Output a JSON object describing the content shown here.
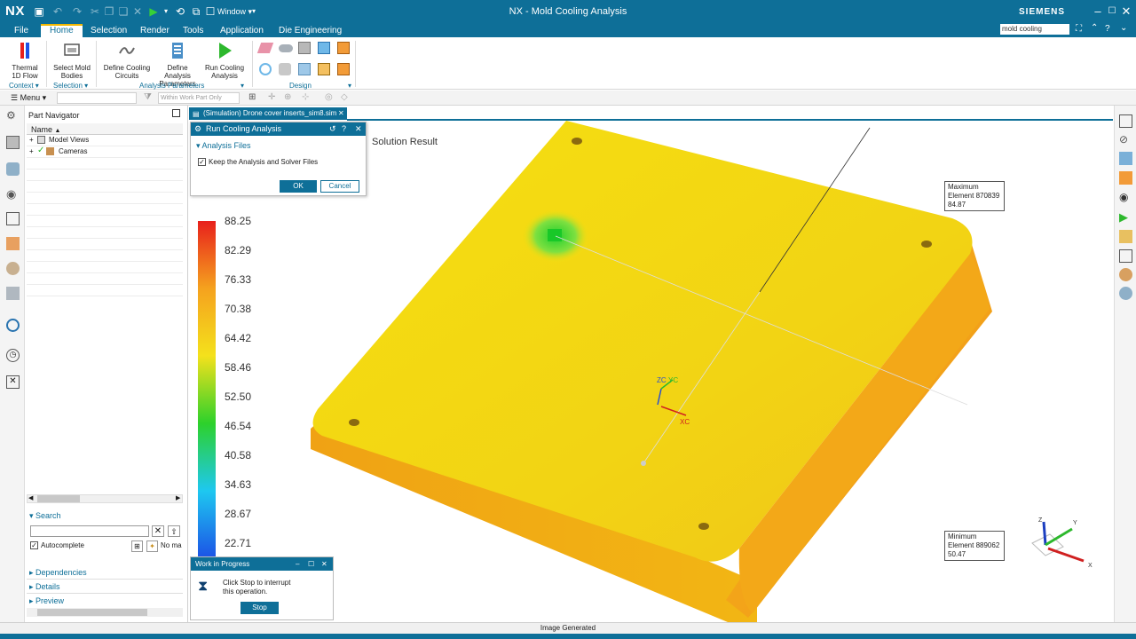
{
  "app": {
    "logo": "NX",
    "window_title": "NX - Mold Cooling Analysis",
    "brand": "SIEMENS",
    "window_menu": "Window"
  },
  "menu_tabs": [
    {
      "label": "File"
    },
    {
      "label": "Home"
    },
    {
      "label": "Selection"
    },
    {
      "label": "Render"
    },
    {
      "label": "Tools"
    },
    {
      "label": "Application"
    },
    {
      "label": "Die Engineering"
    }
  ],
  "command_search": {
    "value": "mold cooling"
  },
  "ribbon": {
    "thermal_flow": "Thermal 1D Flow",
    "select_mold_bodies": "Select Mold Bodies",
    "define_cooling_circuits": "Define Cooling Circuits",
    "define_analysis_parameters": "Define Analysis Parameters",
    "run_cooling_analysis": "Run Cooling Analysis",
    "groups": {
      "context": "Context",
      "selection": "Selection",
      "analysis_parameters": "Analysis Parameters",
      "design": "Design"
    }
  },
  "toolbar": {
    "menu_label": "Menu",
    "filter_placeholder": "Within Work Part Only"
  },
  "part_navigator": {
    "title": "Part Navigator",
    "column_name": "Name",
    "items": [
      {
        "label": "Model Views"
      },
      {
        "label": "Cameras"
      }
    ],
    "sections": {
      "search": "Search",
      "autocomplete": "Autocomplete",
      "no_match": "No ma",
      "dependencies": "Dependencies",
      "details": "Details",
      "preview": "Preview"
    }
  },
  "sim_tab": {
    "label": "(Simulation) Drone cover inserts_sim8.sim"
  },
  "dialog": {
    "title": "Run Cooling Analysis",
    "section": "Analysis Files",
    "checkbox_label": "Keep the Analysis and Solver Files",
    "checkbox_checked": true,
    "ok": "OK",
    "cancel": "Cancel"
  },
  "viewport": {
    "solution_result": "Solution Result",
    "max_annot": {
      "line1": "Maximum",
      "line2": "Element 870839",
      "line3": "84.87"
    },
    "min_annot": {
      "line1": "Minimum",
      "line2": "Element 889062",
      "line3": "50.47"
    },
    "axis_labels": {
      "zc": "ZC",
      "yc": "YC",
      "xc": "XC",
      "x": "X",
      "y": "Y",
      "z": "Z"
    }
  },
  "legend": {
    "values": [
      "88.25",
      "82.29",
      "76.33",
      "70.38",
      "64.42",
      "58.46",
      "52.50",
      "46.54",
      "40.58",
      "34.63",
      "28.67",
      "22.71"
    ],
    "colors": [
      "#e8201c",
      "#f5a21e",
      "#f4e11c",
      "#2dd12b",
      "#1ec8f0",
      "#1c52e6"
    ]
  },
  "work_in_progress": {
    "title": "Work in Progress",
    "message_line1": "Click Stop to interrupt",
    "message_line2": "this operation.",
    "stop": "Stop"
  },
  "status": {
    "text": "Image Generated"
  }
}
